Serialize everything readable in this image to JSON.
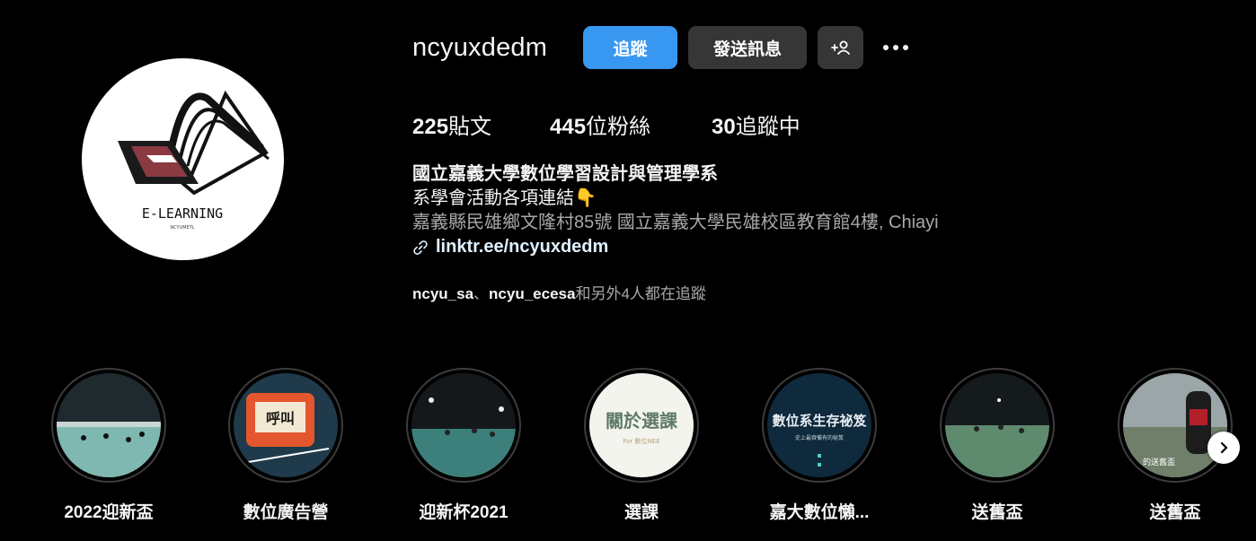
{
  "profile": {
    "username": "ncyuxdedm",
    "follow_label": "追蹤",
    "message_label": "發送訊息",
    "avatar_text": "E-LEARNING",
    "avatar_subtext": "NCYUMETL"
  },
  "stats": {
    "posts_count": "225",
    "posts_label": "貼文",
    "followers_count": "445",
    "followers_label": "位粉絲",
    "following_count": "30",
    "following_label": "追蹤中"
  },
  "bio": {
    "name": "國立嘉義大學數位學習設計與管理學系",
    "line1": "系學會活動各項連結👇",
    "address": "嘉義縣民雄鄉文隆村85號 國立嘉義大學民雄校區教育館4樓, Chiayi",
    "link": "linktr.ee/ncyuxdedm"
  },
  "followed_by": {
    "user1": "ncyu_sa",
    "sep": "、",
    "user2": "ncyu_ecesa",
    "rest": "和另外4人都在追蹤"
  },
  "highlights": [
    {
      "label": "2022迎新盃"
    },
    {
      "label": "數位廣告營",
      "thumb_text": "呼叫"
    },
    {
      "label": "迎新杯2021"
    },
    {
      "label": "選課",
      "thumb_text": "關於選課",
      "thumb_subtext": "For 數位NEE"
    },
    {
      "label": "嘉大數位懶...",
      "thumb_text": "數位系生存祕笈",
      "thumb_subtext": "史上最齊備有的秘笈"
    },
    {
      "label": "送舊盃"
    },
    {
      "label": "送舊盃",
      "thumb_text": "的送舊盃"
    }
  ],
  "colors": {
    "background": "#000000",
    "follow_button": "#3897f0",
    "secondary_button": "#363636",
    "muted_text": "#a8a8a8"
  }
}
